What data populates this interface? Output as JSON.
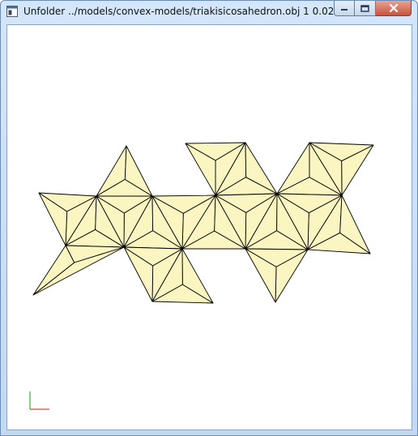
{
  "window": {
    "title": "Unfolder ../models/convex-models/triakisicosahedron.obj 1 0.02",
    "buttons": {
      "minimize": "minimize",
      "maximize": "maximize",
      "close": "close"
    }
  },
  "colors": {
    "face_fill": "#fbf6c1",
    "edge": "#000000",
    "axis_x": "#e04040",
    "axis_y": "#30b030",
    "titlebar": "#c9dcf3"
  },
  "viewport": {
    "model": "triakis icosahedron unfolding",
    "axes_icon": "axes-gizmo-icon"
  }
}
